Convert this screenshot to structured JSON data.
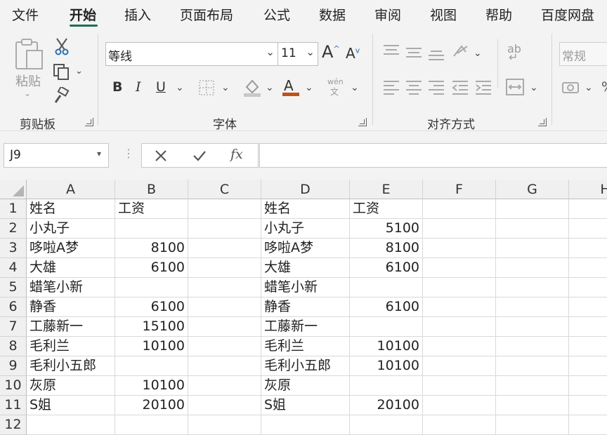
{
  "tabs": [
    "文件",
    "开始",
    "插入",
    "页面布局",
    "公式",
    "数据",
    "审阅",
    "视图",
    "帮助",
    "百度网盘"
  ],
  "active_tab": "开始",
  "ribbon": {
    "clipboard": {
      "paste_label": "粘贴",
      "group_label": "剪贴板"
    },
    "font": {
      "font_name": "等线",
      "font_size": "11",
      "bold": "B",
      "italic": "I",
      "underline": "U",
      "font_color_glyph": "A",
      "phonetic_top": "wén",
      "phonetic_bottom": "文",
      "group_label": "字体",
      "grow_font": "A",
      "shrink_font": "A"
    },
    "alignment": {
      "wrap_glyph": "ab",
      "group_label": "对齐方式"
    },
    "number": {
      "format": "常规"
    }
  },
  "formula_bar": {
    "name_box": "J9",
    "fx": "fx",
    "content": ""
  },
  "columns": [
    "A",
    "B",
    "C",
    "D",
    "E",
    "F",
    "G",
    "H"
  ],
  "rows": [
    [
      "姓名",
      "工资",
      "",
      "姓名",
      "工资",
      "",
      "",
      ""
    ],
    [
      "小丸子",
      "",
      "",
      "小丸子",
      "5100",
      "",
      "",
      ""
    ],
    [
      "哆啦A梦",
      "8100",
      "",
      "哆啦A梦",
      "8100",
      "",
      "",
      ""
    ],
    [
      "大雄",
      "6100",
      "",
      "大雄",
      "6100",
      "",
      "",
      ""
    ],
    [
      "蜡笔小新",
      "",
      "",
      "蜡笔小新",
      "",
      "",
      "",
      ""
    ],
    [
      "静香",
      "6100",
      "",
      "静香",
      "6100",
      "",
      "",
      ""
    ],
    [
      "工藤新一",
      "15100",
      "",
      "工藤新一",
      "",
      "",
      "",
      ""
    ],
    [
      "毛利兰",
      "10100",
      "",
      "毛利兰",
      "10100",
      "",
      "",
      ""
    ],
    [
      "毛利小五郎",
      "",
      "",
      "毛利小五郎",
      "10100",
      "",
      "",
      ""
    ],
    [
      "灰原",
      "10100",
      "",
      "灰原",
      "",
      "",
      "",
      ""
    ],
    [
      "S姐",
      "20100",
      "",
      "S姐",
      "20100",
      "",
      "",
      ""
    ],
    [
      "",
      "",
      "",
      "",
      "",
      "",
      "",
      ""
    ]
  ],
  "row_numbers": [
    "1",
    "2",
    "3",
    "4",
    "5",
    "6",
    "7",
    "8",
    "9",
    "10",
    "11",
    "12"
  ],
  "colors": {
    "accent": "#1e6f4f",
    "font_color_bar": "#c0501c"
  }
}
